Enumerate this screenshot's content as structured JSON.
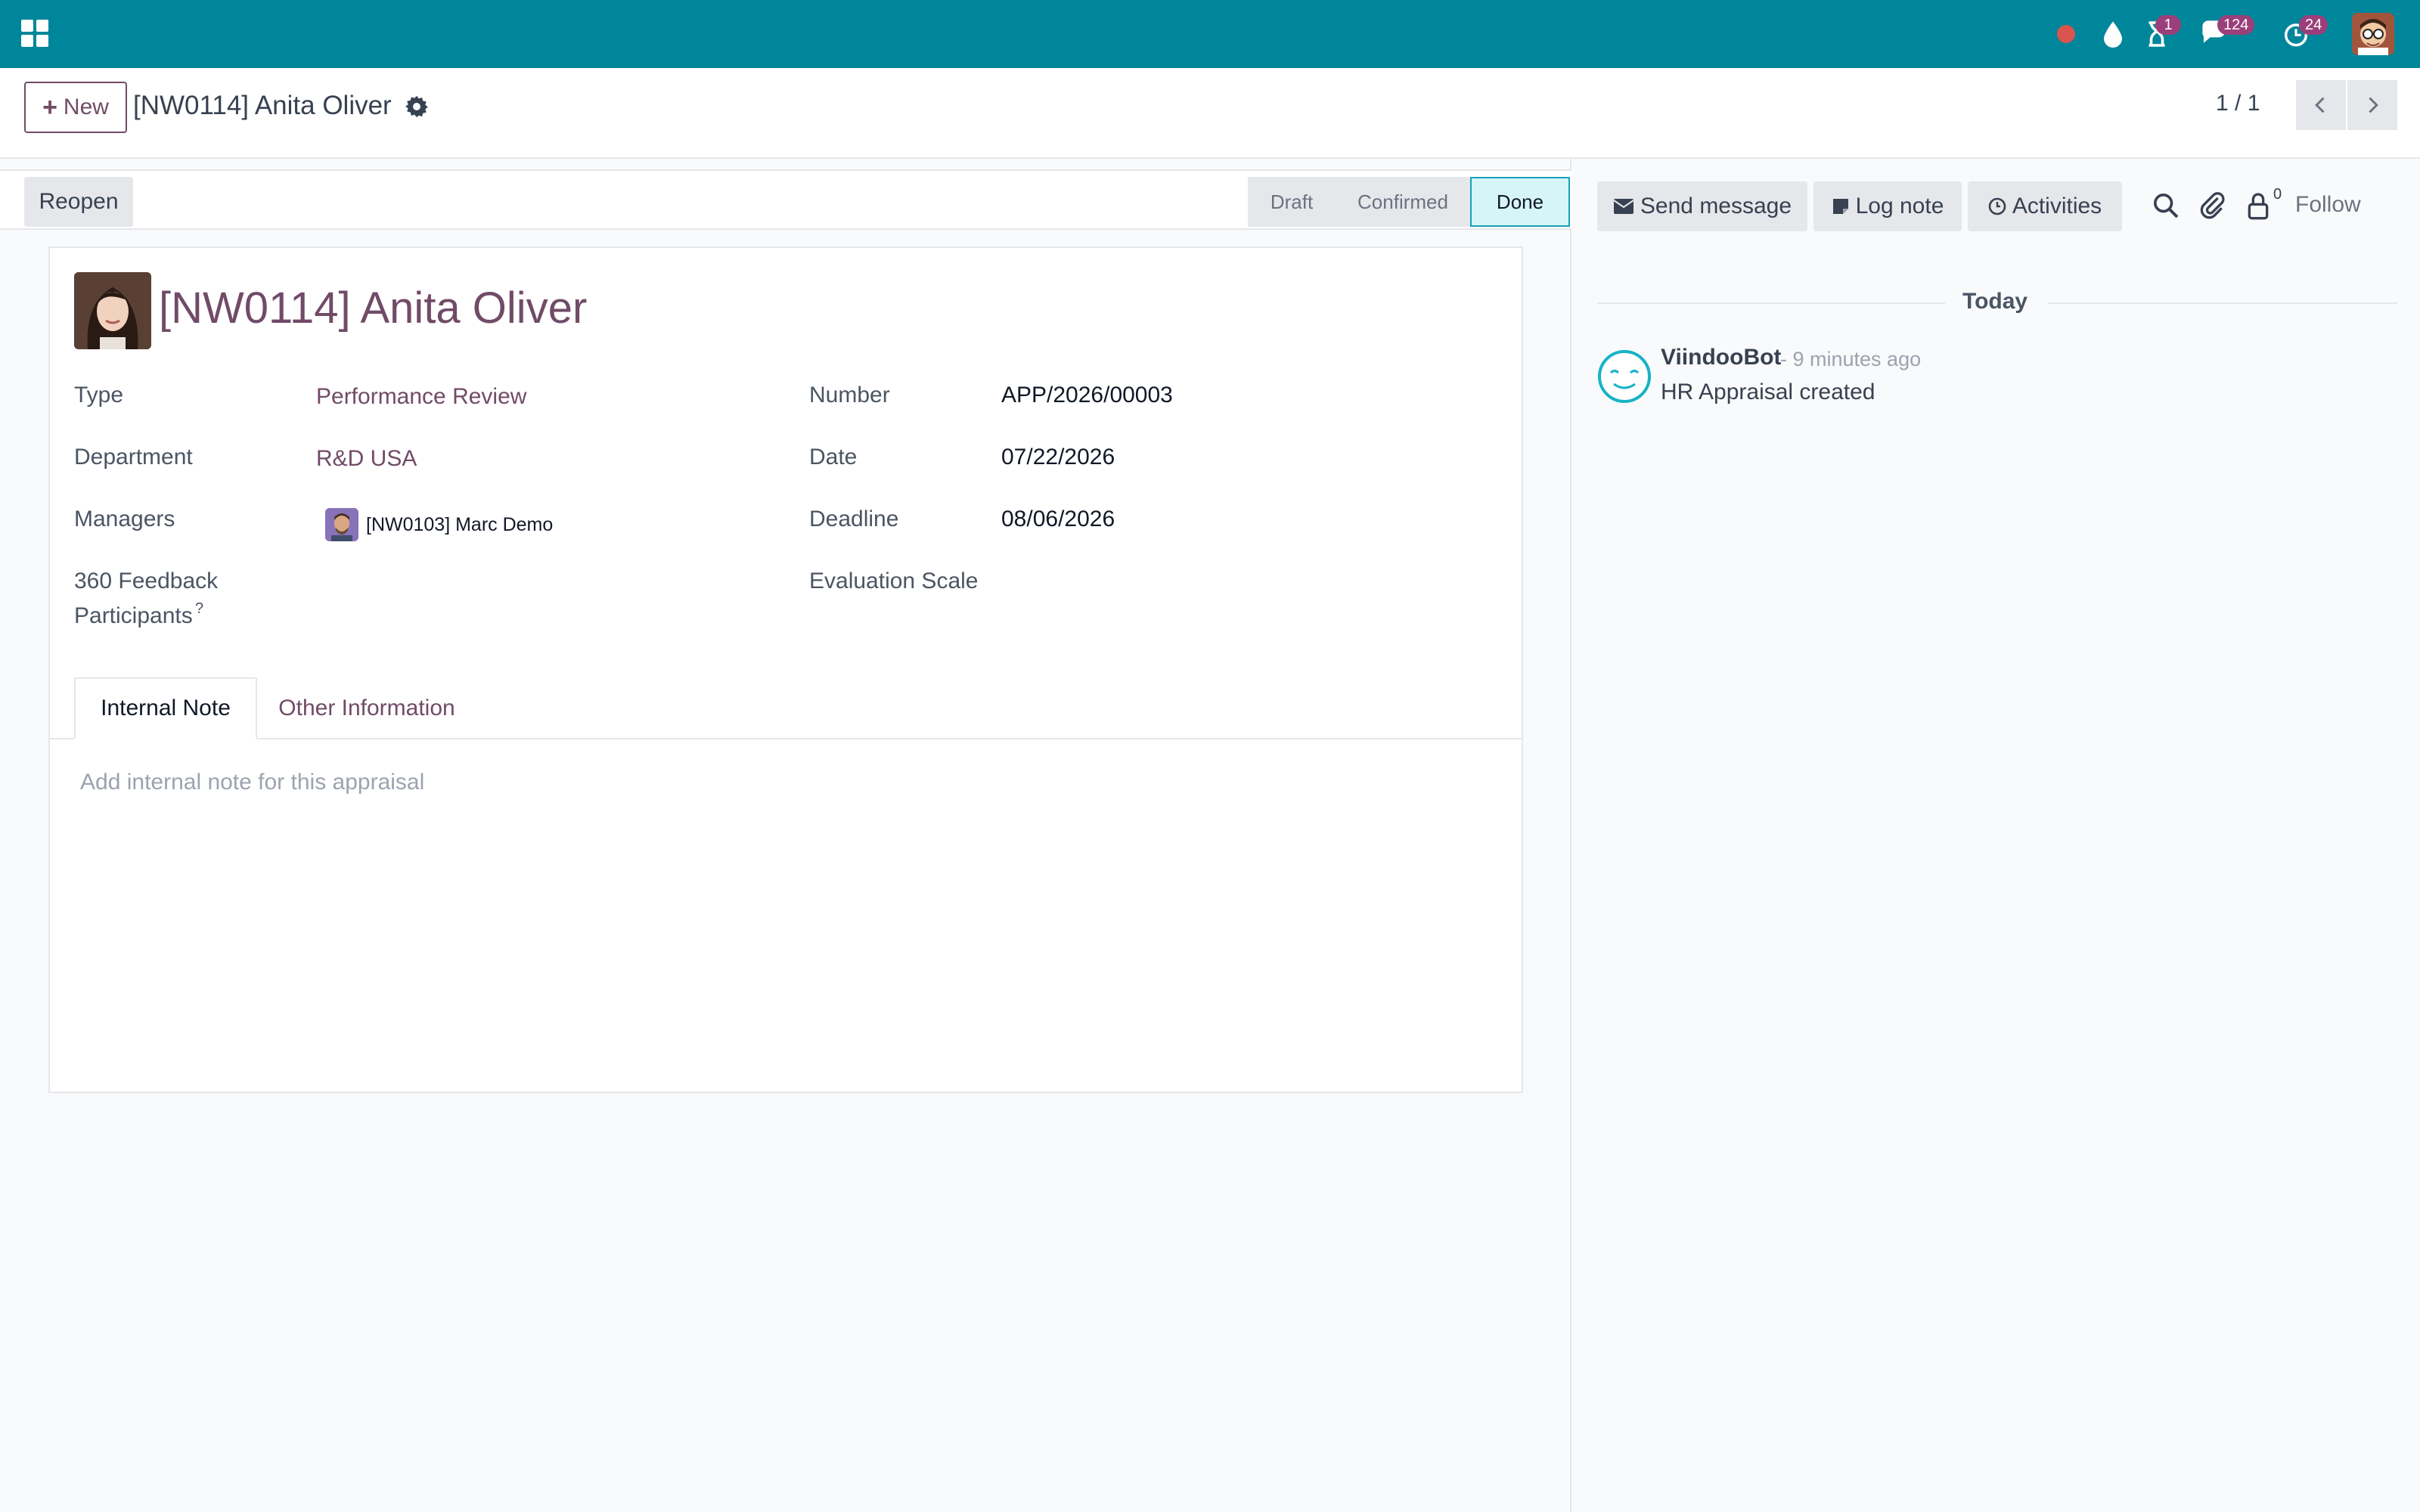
{
  "navbar": {
    "apps_icon": "apps-grid-icon",
    "systray": {
      "recording_icon": "record-dot-icon",
      "drop_icon": "water-drop-icon",
      "activities_badge": "1",
      "messages_badge": "124",
      "clock_badge": "24"
    }
  },
  "control_panel": {
    "new_label": "New",
    "breadcrumb": "[NW0114] Anita Oliver",
    "pager": "1 / 1"
  },
  "statusbar": {
    "reopen_label": "Reopen",
    "stages": [
      "Draft",
      "Confirmed",
      "Done"
    ],
    "active_stage": "Done"
  },
  "form": {
    "title": "[NW0114] Anita Oliver",
    "type_label": "Type",
    "type_value": "Performance Review",
    "department_label": "Department",
    "department_value": "R&D USA",
    "managers_label": "Managers",
    "managers_value": "[NW0103] Marc Demo",
    "feedback_label_1": "360 Feedback",
    "feedback_label_2": "Participants",
    "feedback_help": "?",
    "number_label": "Number",
    "number_value": "APP/2026/00003",
    "date_label": "Date",
    "date_value": "07/22/2026",
    "deadline_label": "Deadline",
    "deadline_value": "08/06/2026",
    "scale_label": "Evaluation Scale",
    "tabs": [
      "Internal Note",
      "Other Information"
    ],
    "note_placeholder": "Add internal note for this appraisal"
  },
  "chatter": {
    "send_message": "Send message",
    "log_note": "Log note",
    "activities": "Activities",
    "followers_count": "0",
    "follow_label": "Follow",
    "today_label": "Today",
    "messages": [
      {
        "author": "ViindooBot",
        "time": "- 9 minutes ago",
        "body": "HR Appraisal created"
      }
    ]
  },
  "colors": {
    "navbar": "#00869a",
    "brand": "#714b67",
    "active_stage_bg": "#d6f5f8",
    "active_stage_border": "#17a2b8"
  }
}
